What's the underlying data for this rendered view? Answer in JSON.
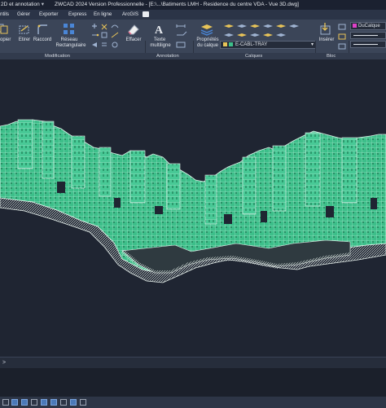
{
  "titlebar": {
    "workspace": "2D et annotation",
    "title": "ZWCAD 2024 Version Professionnelle - [E:\\...\\Batiments LMH - Residence du centre VDA - Vue 3D.dwg]"
  },
  "menu": {
    "items": [
      "ntils",
      "Gérer",
      "Exporter",
      "Express",
      "En ligne",
      "ArcGIS"
    ]
  },
  "ribbon": {
    "copier": "opier",
    "etirer": "Etirer",
    "raccord": "Raccord",
    "reseau": "Réseau",
    "rectangulaire": "Rectangulaire",
    "effacer": "Effacer",
    "texte": "Texte",
    "multiligne": "multiligne",
    "proprietes": "Propriétés",
    "du_calque": "du calque",
    "layer_current": "E-CABL-TRAY",
    "inserer": "Insérer",
    "style_current": "DuCalque",
    "accent_color": "#e040c8"
  },
  "panels": {
    "modification": "Modification",
    "annotation": "Annotation",
    "calques": "Calques",
    "bloc": "Bloc"
  },
  "viewport": {
    "model_color": "#3dbf8a",
    "edge_color": "#e8f2ee",
    "background": "#1f2532"
  },
  "command": {
    "prompt_symbol": ">"
  },
  "icons": {
    "workspace_chevron": "chevron-down-icon",
    "copy": "copy-icon",
    "stretch": "stretch-icon",
    "fillet": "fillet-icon",
    "array": "array-icon",
    "erase": "erase-icon",
    "text": "text-icon",
    "layer_props": "layer-properties-icon",
    "insert": "insert-block-icon"
  }
}
